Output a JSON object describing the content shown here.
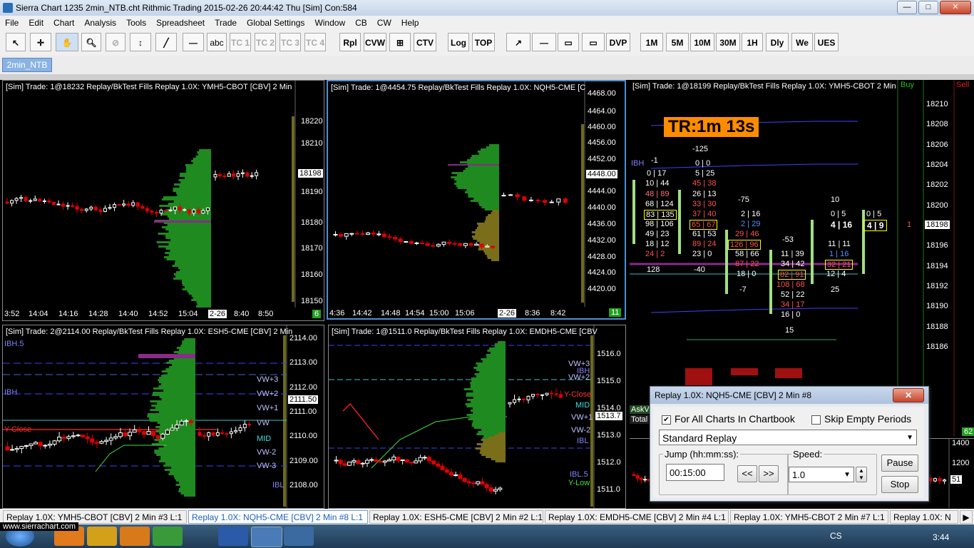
{
  "app": {
    "title": "Sierra Chart 1235 2min_NTB.cht  Rithmic Trading 2015-02-26  20:44:42 Thu [Sim]  Con:584",
    "window_buttons": [
      "—",
      "□",
      "✕"
    ]
  },
  "menu": [
    "File",
    "Edit",
    "Chart",
    "Analysis",
    "Tools",
    "Spreadsheet",
    "Trade",
    "Global Settings",
    "Window",
    "CB",
    "CW",
    "Help"
  ],
  "toolbar": {
    "text_buttons": [
      "abc",
      "TC 1",
      "TC 2",
      "TC 3",
      "TC 4",
      "Rpl",
      "CVW",
      "CTV",
      "Log",
      "TOP",
      "DVP",
      "1M",
      "5M",
      "10M",
      "30M",
      "1H",
      "Dly",
      "We",
      "UES"
    ]
  },
  "chartbook_tab": "2min_NTB",
  "charts": {
    "ymh5_left": {
      "header": "[Sim]  Trade: 1@18232  Replay/BkTest Fills  Replay 1.0X: YMH5-CBOT [CBV]  2 Min",
      "prices": [
        "18220",
        "18210",
        "18200",
        "18190",
        "18180",
        "18170",
        "18160",
        "18150"
      ],
      "current_price": "18198",
      "times": [
        "3:52",
        "14:04",
        "14:16",
        "14:28",
        "14:40",
        "14:52",
        "15:04",
        "2-26",
        "8:40",
        "8:50"
      ],
      "chart_number": "6"
    },
    "nqh5": {
      "header": "[Sim]  Trade: 1@4454.75  Replay/BkTest Fills  Replay 1.0X: NQH5-CME [C",
      "prices": [
        "4468.00",
        "4464.00",
        "4460.00",
        "4456.00",
        "4452.00",
        "4448.00",
        "4444.00",
        "4440.00",
        "4436.00",
        "4432.00",
        "4428.00",
        "4424.00",
        "4420.00"
      ],
      "current_price": "4448.00",
      "times": [
        "4:36",
        "14:42",
        "14:48",
        "14:54",
        "15:00",
        "15:06",
        "2-26",
        "8:36",
        "8:42"
      ],
      "chart_number": "11"
    },
    "esh5": {
      "header": "[Sim]  Trade: 2@2114.00  Replay/BkTest Fills  Replay 1.0X: ESH5-CME [CBV]  2 Min",
      "prices": [
        "2114.00",
        "2113.00",
        "2112.00",
        "2111.00",
        "2110.00",
        "2109.00",
        "2108.00"
      ],
      "current_price": "2111.50",
      "labels": [
        "IBH.5",
        "IBH",
        "Y-Close",
        "VW+3",
        "VW+2",
        "VW+1",
        "VW",
        "MID",
        "VW-2",
        "VW-3",
        "IBL"
      ]
    },
    "emdh5": {
      "header": "[Sim]  Trade: 1@1511.0  Replay/BkTest Fills  Replay 1.0X: EMDH5-CME [CBV",
      "prices": [
        "1516.0",
        "1515.0",
        "1514.0",
        "1513.0",
        "1512.0",
        "1511.0"
      ],
      "current_price": "1513.7",
      "labels": [
        "VW+3",
        "IBH",
        "VW+2",
        "Y-Close",
        "MID",
        "VW+1",
        "VW-2",
        "IBL",
        "IBL.5",
        "Y-Low"
      ]
    },
    "ymh5_dom": {
      "header": "[Sim]  Trade: 1@18199  Replay/BkTest Fills  Replay 1.0X: YMH5-CBOT  2 Min",
      "buy_label": "Buy",
      "sell_label": "Sell",
      "timer": "TR:1m 13s",
      "prices": [
        "18210",
        "18208",
        "18206",
        "18204",
        "18202",
        "18200",
        "18198",
        "18196",
        "18194",
        "18192",
        "18190",
        "18188",
        "18186"
      ],
      "current_price": "18198",
      "ibh": "IBH",
      "footprint": [
        [
          "-1",
          "-125"
        ],
        [
          "0 | 17",
          "0 | 0"
        ],
        [
          "10 | 44",
          "5 | 25"
        ],
        [
          "48 | 89",
          "45 | 38"
        ],
        [
          "68 | 124",
          "26 | 13"
        ],
        [
          "83 | 135",
          "33 | 30"
        ],
        [
          "98 | 106",
          "37 | 40"
        ],
        [
          "49 | 23",
          "65 | 67"
        ],
        [
          "18 | 12",
          "61 | 53"
        ],
        [
          "24 | 2",
          "89 | 24"
        ],
        [
          "128",
          "23 | 0"
        ],
        [
          "-40"
        ]
      ],
      "footprint2": [
        "-75",
        "2 | 16",
        "2 | 29",
        "29 | 46",
        "126 | 96",
        "58 | 66",
        "87 | 22",
        "18 | 0",
        "-7"
      ],
      "footprint3": [
        "-53",
        "11 | 39",
        "34 | 42",
        "82 | 91",
        "108 | 68",
        "52 | 22",
        "34 | 17",
        "16 | 0",
        "15"
      ],
      "footprint4": [
        "10",
        "0 | 5",
        "4 | 16",
        "11 | 11",
        "1 | 16",
        "32 | 21",
        "12 | 4",
        "25"
      ],
      "footprint5": [
        "0 | 5",
        "4 | 9"
      ],
      "sell_vol": "1",
      "askv_label": "AskV",
      "total_label": "Total",
      "right_count": "62"
    },
    "small_chart": {
      "prices": [
        "1400",
        "1200"
      ],
      "value": "51"
    }
  },
  "replay_dialog": {
    "title": "Replay 1.0X: NQH5-CME [CBV]  2 Min   #8",
    "for_all_charts": "For All Charts In Chartbook",
    "for_all_checked": true,
    "skip_empty": "Skip Empty Periods",
    "skip_checked": false,
    "mode": "Standard Replay",
    "jump_label": "Jump (hh:mm:ss):",
    "jump_value": "00:15:00",
    "back_btn": "<<",
    "fwd_btn": ">>",
    "speed_label": "Speed:",
    "speed_value": "1.0",
    "pause_btn": "Pause",
    "stop_btn": "Stop"
  },
  "bottom_tabs": [
    "Replay 1.0X: YMH5-CBOT [CBV]  2 Min   #3  L:1",
    "Replay 1.0X: NQH5-CME [CBV]  2 Min   #8  L:1",
    "Replay 1.0X: ESH5-CME [CBV]  2 Min   #2  L:1",
    "Replay 1.0X: EMDH5-CME [CBV]  2 Min   #4  L:1",
    "Replay 1.0X: YMH5-CBOT  2 Min   #7  L:1",
    "Replay 1.0X: N"
  ],
  "status": {
    "url": "www.sierrachart.com",
    "lang": "CS",
    "clock": "3:44"
  },
  "colors": {
    "up_candle": "#ffffff",
    "down_candle": "#e00000",
    "profile_green": "#1f8a1f",
    "profile_olive": "#7a6e1a",
    "timer_bg": "#ff8c00"
  }
}
